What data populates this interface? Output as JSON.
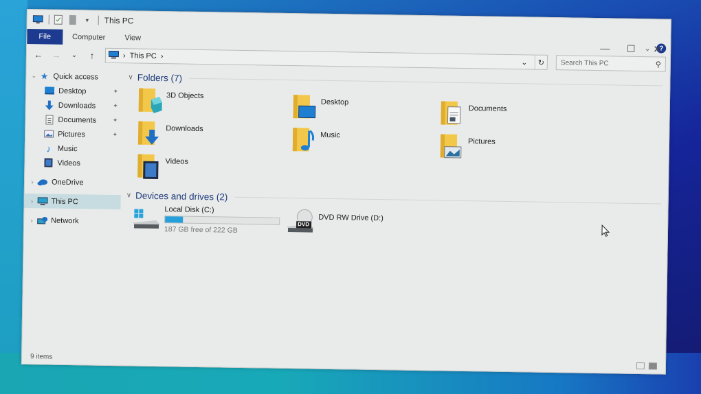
{
  "window": {
    "title": "This PC",
    "quick_access_icons": [
      "computer-icon",
      "properties-icon",
      "new-folder-icon",
      "customize-dropdown-icon"
    ],
    "controls": {
      "minimize": "—",
      "maximize": "☐",
      "close": "✕"
    }
  },
  "ribbon": {
    "tabs": [
      {
        "label": "File",
        "active": true
      },
      {
        "label": "Computer"
      },
      {
        "label": "View"
      }
    ],
    "expand_glyph": "⌄",
    "help_glyph": "?"
  },
  "nav": {
    "back": "←",
    "forward": "→",
    "recent": "⌄",
    "up": "↑",
    "breadcrumb": [
      "This PC"
    ],
    "breadcrumb_sep": "›",
    "dropdown_glyph": "⌄",
    "refresh_glyph": "↻",
    "search_placeholder": "Search This PC",
    "search_glyph": "⚲"
  },
  "sidebar": {
    "quick_access": {
      "label": "Quick access",
      "expanded": true,
      "items": [
        {
          "label": "Desktop",
          "icon": "desktop-icon",
          "pinned": true
        },
        {
          "label": "Downloads",
          "icon": "downloads-icon",
          "pinned": true
        },
        {
          "label": "Documents",
          "icon": "documents-icon",
          "pinned": true
        },
        {
          "label": "Pictures",
          "icon": "pictures-icon",
          "pinned": true
        },
        {
          "label": "Music",
          "icon": "music-icon",
          "pinned": false
        },
        {
          "label": "Videos",
          "icon": "videos-icon",
          "pinned": false
        }
      ]
    },
    "roots": [
      {
        "label": "OneDrive",
        "icon": "onedrive-icon",
        "selected": false
      },
      {
        "label": "This PC",
        "icon": "this-pc-icon",
        "selected": true
      },
      {
        "label": "Network",
        "icon": "network-icon",
        "selected": false
      }
    ],
    "pin_glyph": "📌",
    "chevron_right": "›",
    "chevron_down": "⌄"
  },
  "main": {
    "folders_group": {
      "label": "Folders (7)",
      "items": [
        {
          "label": "3D Objects",
          "icon": "3d-objects-icon"
        },
        {
          "label": "Desktop",
          "icon": "desktop-icon"
        },
        {
          "label": "Documents",
          "icon": "documents-icon"
        },
        {
          "label": "Downloads",
          "icon": "downloads-icon"
        },
        {
          "label": "Music",
          "icon": "music-icon"
        },
        {
          "label": "Pictures",
          "icon": "pictures-icon"
        },
        {
          "label": "Videos",
          "icon": "videos-icon"
        }
      ]
    },
    "drives_group": {
      "label": "Devices and drives (2)",
      "items": [
        {
          "label": "Local Disk (C:)",
          "icon": "local-disk-icon",
          "free_text": "187 GB free of 222 GB",
          "used_fraction": 0.158
        },
        {
          "label": "DVD RW Drive (D:)",
          "icon": "dvd-drive-icon",
          "badge": "DVD"
        }
      ]
    }
  },
  "status": {
    "items_count": "9 items"
  },
  "colors": {
    "accent": "#1c3a8f",
    "header_text": "#1e3a7a",
    "bar_fill": "#26a0da",
    "selected_bg": "#c7dce0",
    "folder_yellow": "#f3c84a"
  }
}
